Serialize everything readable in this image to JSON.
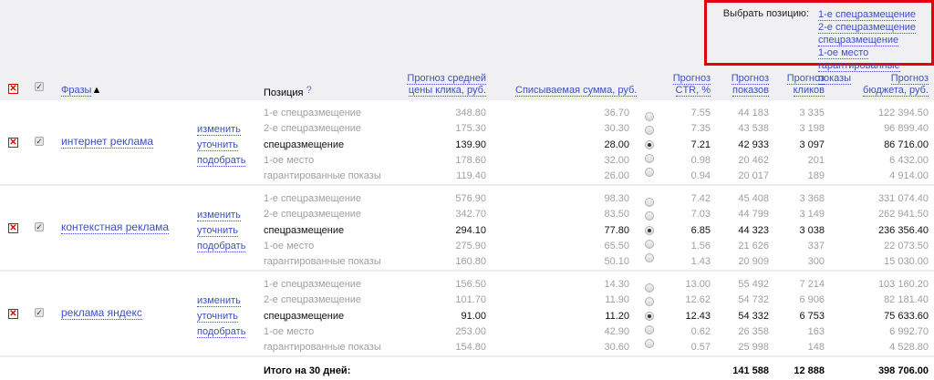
{
  "picker": {
    "label": "Выбрать позицию:",
    "options": [
      "1-е спецразмещение",
      "2-е спецразмещение",
      "спецразмещение",
      "1-ое место",
      "гарантированные показы"
    ]
  },
  "header": {
    "phrases": "Фразы",
    "sort_arrow": "▲",
    "position": "Позиция",
    "help": "?",
    "price": [
      "Прогноз средней",
      "цены клика, руб."
    ],
    "charge": "Списываемая сумма, руб.",
    "ctr": [
      "Прогноз",
      "CTR, %"
    ],
    "shows": [
      "Прогноз",
      "показов"
    ],
    "clicks": [
      "Прогноз",
      "кликов"
    ],
    "budget": [
      "Прогноз",
      "бюджета, руб."
    ]
  },
  "actions": [
    "изменить",
    "уточнить",
    "подобрать"
  ],
  "groups": [
    {
      "phrase": "интернет реклама",
      "selected": 2,
      "rows": [
        [
          "1-е спецразмещение",
          "348.80",
          "36.70",
          "7.55",
          "44 183",
          "3 335",
          "122 394.50"
        ],
        [
          "2-е спецразмещение",
          "175.30",
          "30.30",
          "7.35",
          "43 538",
          "3 198",
          "96 899.40"
        ],
        [
          "спецразмещение",
          "139.90",
          "28.00",
          "7.21",
          "42 933",
          "3 097",
          "86 716.00"
        ],
        [
          "1-ое место",
          "178.60",
          "32.00",
          "0.98",
          "20 462",
          "201",
          "6 432.00"
        ],
        [
          "гарантированные показы",
          "119.40",
          "26.00",
          "0.94",
          "20 017",
          "189",
          "4 914.00"
        ]
      ]
    },
    {
      "phrase": "контекстная реклама",
      "selected": 2,
      "rows": [
        [
          "1-е спецразмещение",
          "576.90",
          "98.30",
          "7.42",
          "45 408",
          "3 368",
          "331 074.40"
        ],
        [
          "2-е спецразмещение",
          "342.70",
          "83.50",
          "7.03",
          "44 799",
          "3 149",
          "262 941.50"
        ],
        [
          "спецразмещение",
          "294.10",
          "77.80",
          "6.85",
          "44 323",
          "3 038",
          "236 356.40"
        ],
        [
          "1-ое место",
          "275.90",
          "65.50",
          "1.56",
          "21 626",
          "337",
          "22 073.50"
        ],
        [
          "гарантированные показы",
          "160.80",
          "50.10",
          "1.43",
          "20 909",
          "300",
          "15 030.00"
        ]
      ]
    },
    {
      "phrase": "реклама яндекс",
      "selected": 2,
      "rows": [
        [
          "1-е спецразмещение",
          "156.50",
          "14.30",
          "13.00",
          "55 492",
          "7 214",
          "103 160.20"
        ],
        [
          "2-е спецразмещение",
          "101.70",
          "11.90",
          "12.62",
          "54 732",
          "6 906",
          "82 181.40"
        ],
        [
          "спецразмещение",
          "91.00",
          "11.20",
          "12.43",
          "54 332",
          "6 753",
          "75 633.60"
        ],
        [
          "1-ое место",
          "253.00",
          "42.90",
          "0.62",
          "26 358",
          "163",
          "6 992.70"
        ],
        [
          "гарантированные показы",
          "154.80",
          "30.60",
          "0.57",
          "25 998",
          "148",
          "4 528.80"
        ]
      ]
    }
  ],
  "total": {
    "label": "Итого на 30 дней:",
    "shows": "141 588",
    "clicks": "12 888",
    "budget": "398 706.00"
  }
}
